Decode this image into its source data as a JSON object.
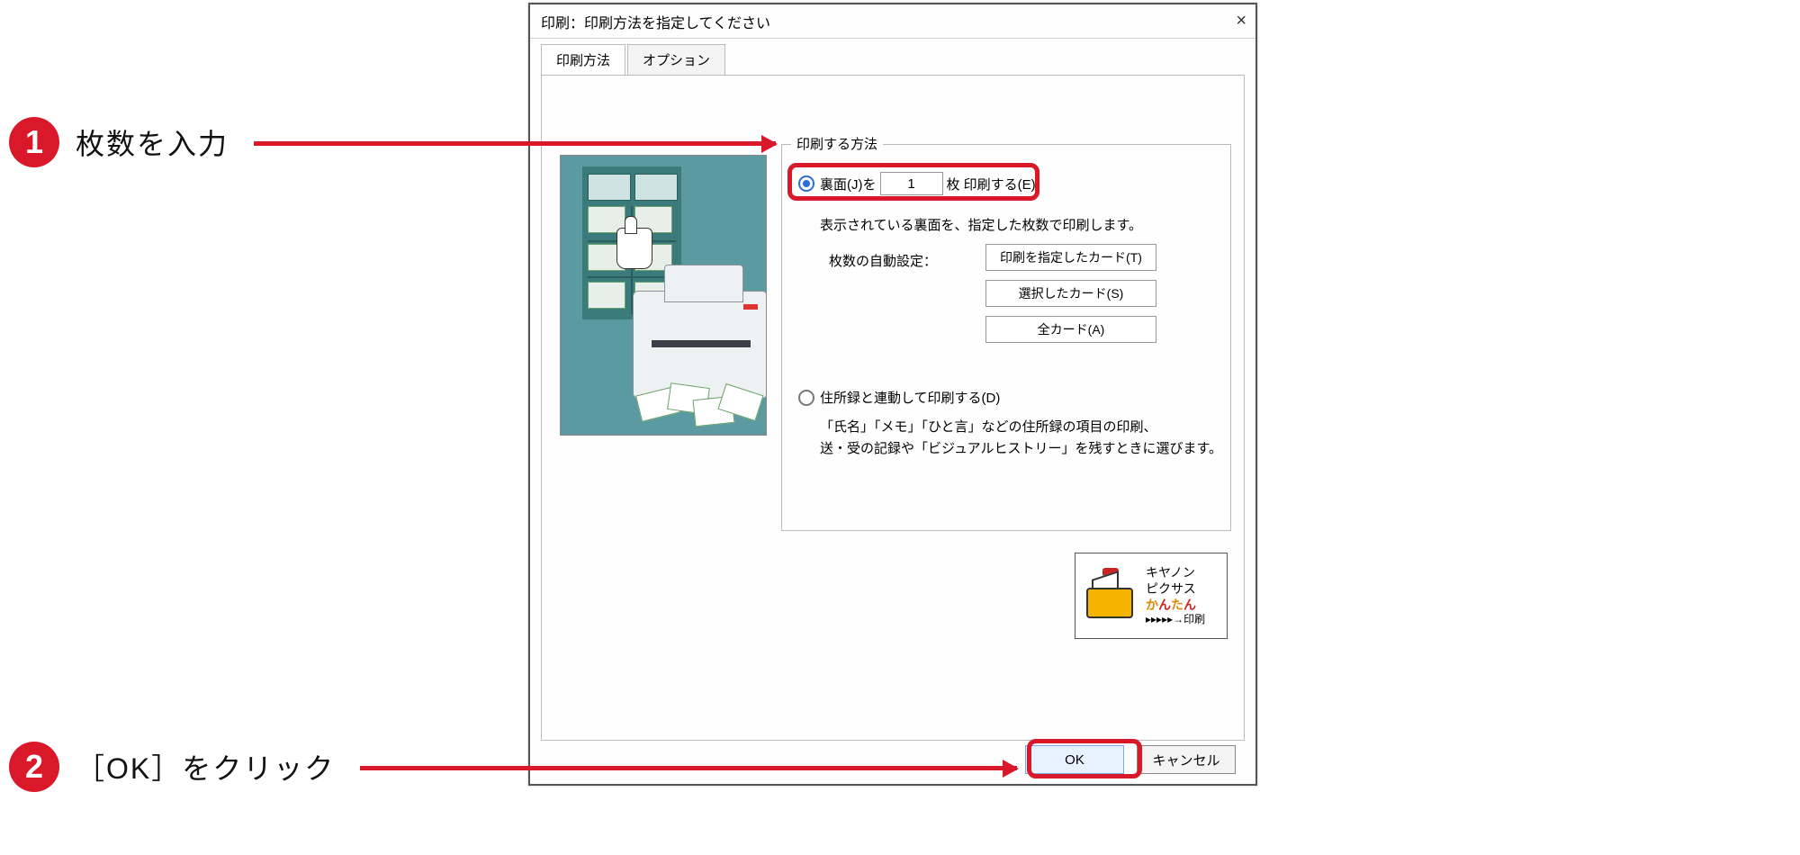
{
  "callouts": {
    "step1": {
      "num": "1",
      "text": "枚数を入力"
    },
    "step2": {
      "num": "2",
      "text": "［OK］をクリック"
    }
  },
  "dialog": {
    "title": "印刷：印刷方法を指定してください",
    "close": "×",
    "tabs": {
      "method": "印刷方法",
      "option": "オプション"
    },
    "group_title": "印刷する方法",
    "row1": {
      "prefix": "裏面(J)を",
      "copies": "1",
      "suffix": "枚 印刷する(E)"
    },
    "row1_desc": "表示されている裏面を、指定した枚数で印刷します。",
    "autoset_label": "枚数の自動設定：",
    "auto_buttons": {
      "specified": "印刷を指定したカード(T)",
      "selected": "選択したカード(S)",
      "all": "全カード(A)"
    },
    "row2": {
      "label": "住所録と連動して印刷する(D)",
      "desc1": "「氏名」「メモ」「ひと言」などの住所録の項目の印刷、",
      "desc2": "送・受の記録や「ビジュアルヒストリー」を残すときに選びます。"
    },
    "logo": {
      "line1": "キヤノン",
      "line2": "ピクサス",
      "kantan_ka": "か",
      "kantan_n": "ん",
      "kantan_ta": "た",
      "kantan_n2": "ん",
      "line4": "▸▸▸▸▸→印刷"
    },
    "buttons": {
      "ok": "OK",
      "cancel": "キャンセル"
    }
  }
}
